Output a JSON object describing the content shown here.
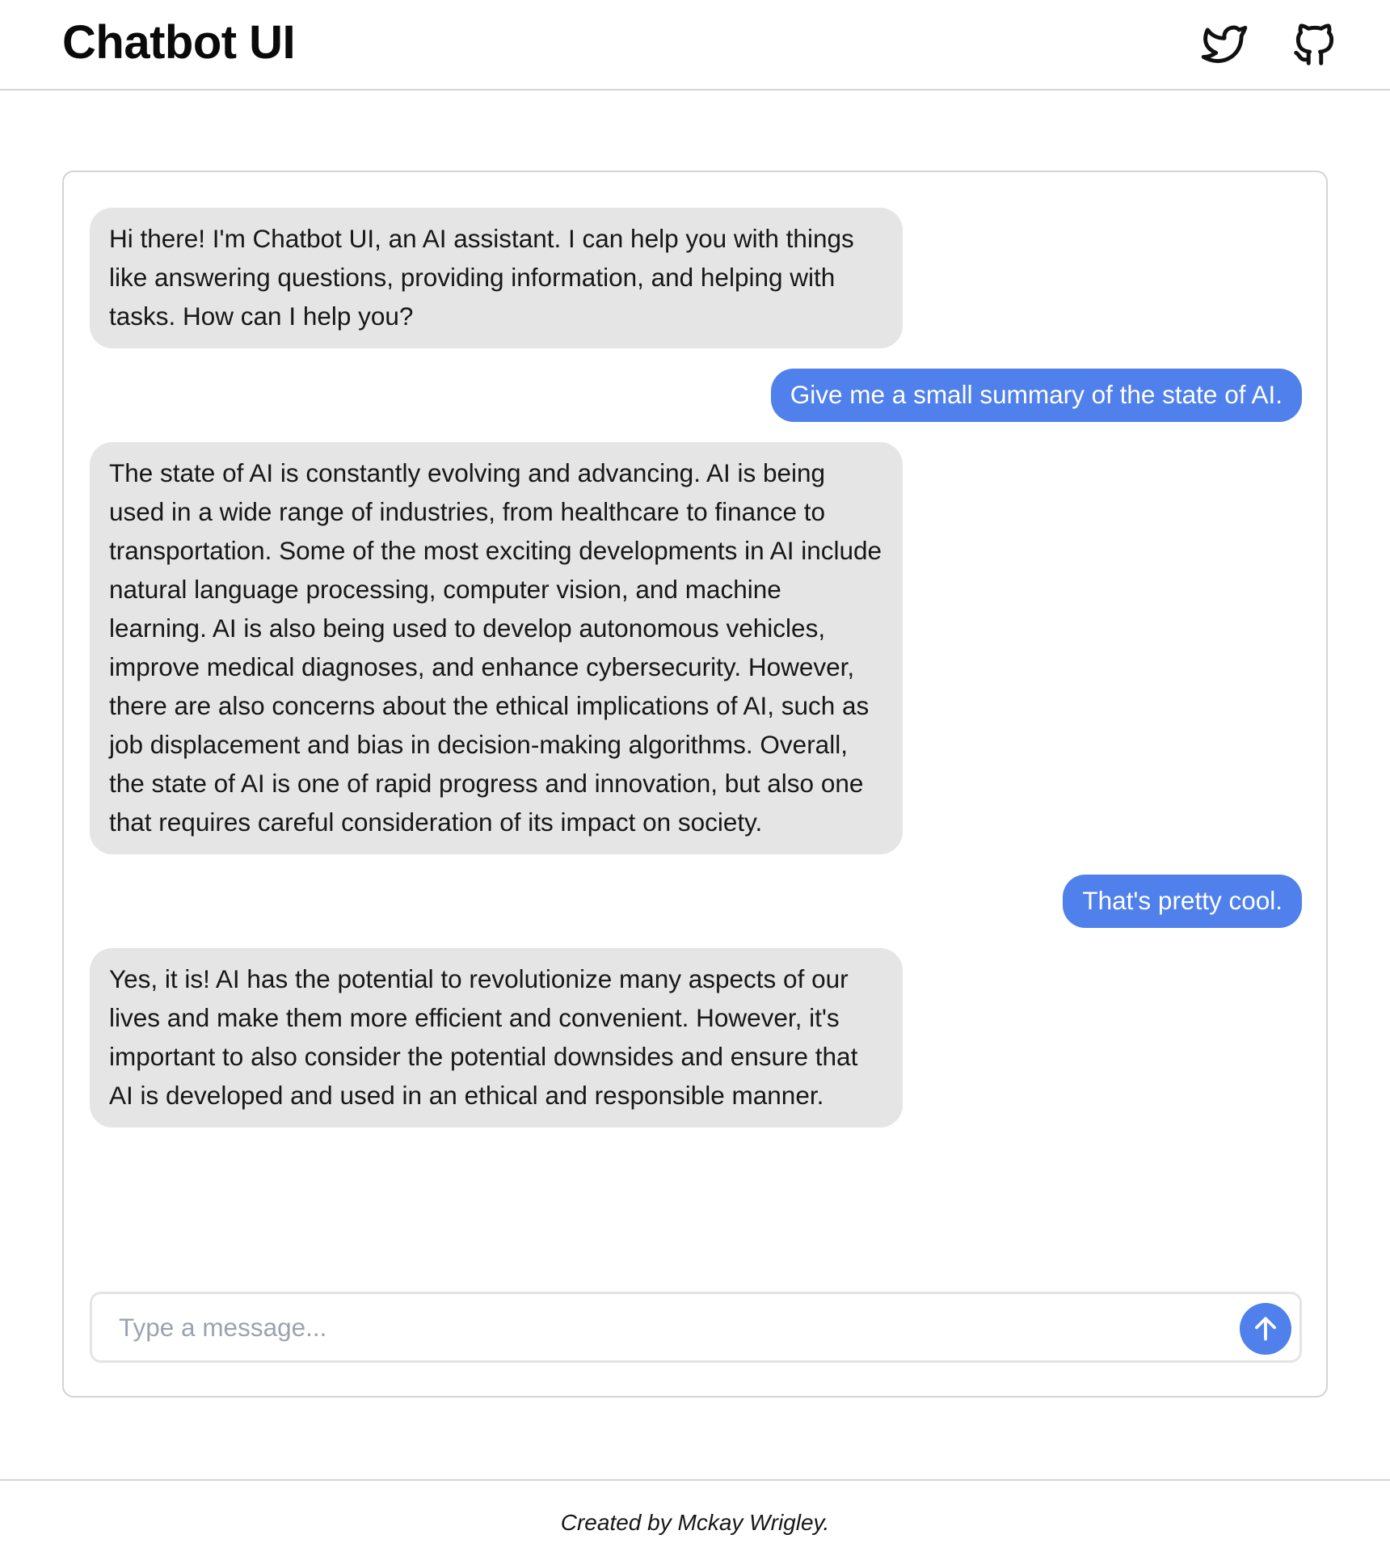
{
  "header": {
    "title": "Chatbot UI",
    "icons": [
      "twitter-icon",
      "github-icon"
    ]
  },
  "messages": [
    {
      "role": "assistant",
      "text": "Hi there! I'm Chatbot UI, an AI assistant. I can help you with things like answering questions, providing information, and helping with tasks. How can I help you?"
    },
    {
      "role": "user",
      "text": "Give me a small summary of the state of AI."
    },
    {
      "role": "assistant",
      "text": "The state of AI is constantly evolving and advancing. AI is being used in a wide range of industries, from healthcare to finance to transportation. Some of the most exciting developments in AI include natural language processing, computer vision, and machine learning. AI is also being used to develop autonomous vehicles, improve medical diagnoses, and enhance cybersecurity. However, there are also concerns about the ethical implications of AI, such as job displacement and bias in decision-making algorithms. Overall, the state of AI is one of rapid progress and innovation, but also one that requires careful consideration of its impact on society."
    },
    {
      "role": "user",
      "text": "That's pretty cool."
    },
    {
      "role": "assistant",
      "text": "Yes, it is! AI has the potential to revolutionize many aspects of our lives and make them more efficient and convenient. However, it's important to also consider the potential downsides and ensure that AI is developed and used in an ethical and responsible manner."
    }
  ],
  "input": {
    "placeholder": "Type a message...",
    "value": "",
    "send_icon": "arrow-up-icon"
  },
  "footer": {
    "text": "Created by Mckay Wrigley."
  },
  "colors": {
    "user_bubble": "#4f80ec",
    "assistant_bubble": "#e5e5e5",
    "border": "#d4d4d8"
  }
}
